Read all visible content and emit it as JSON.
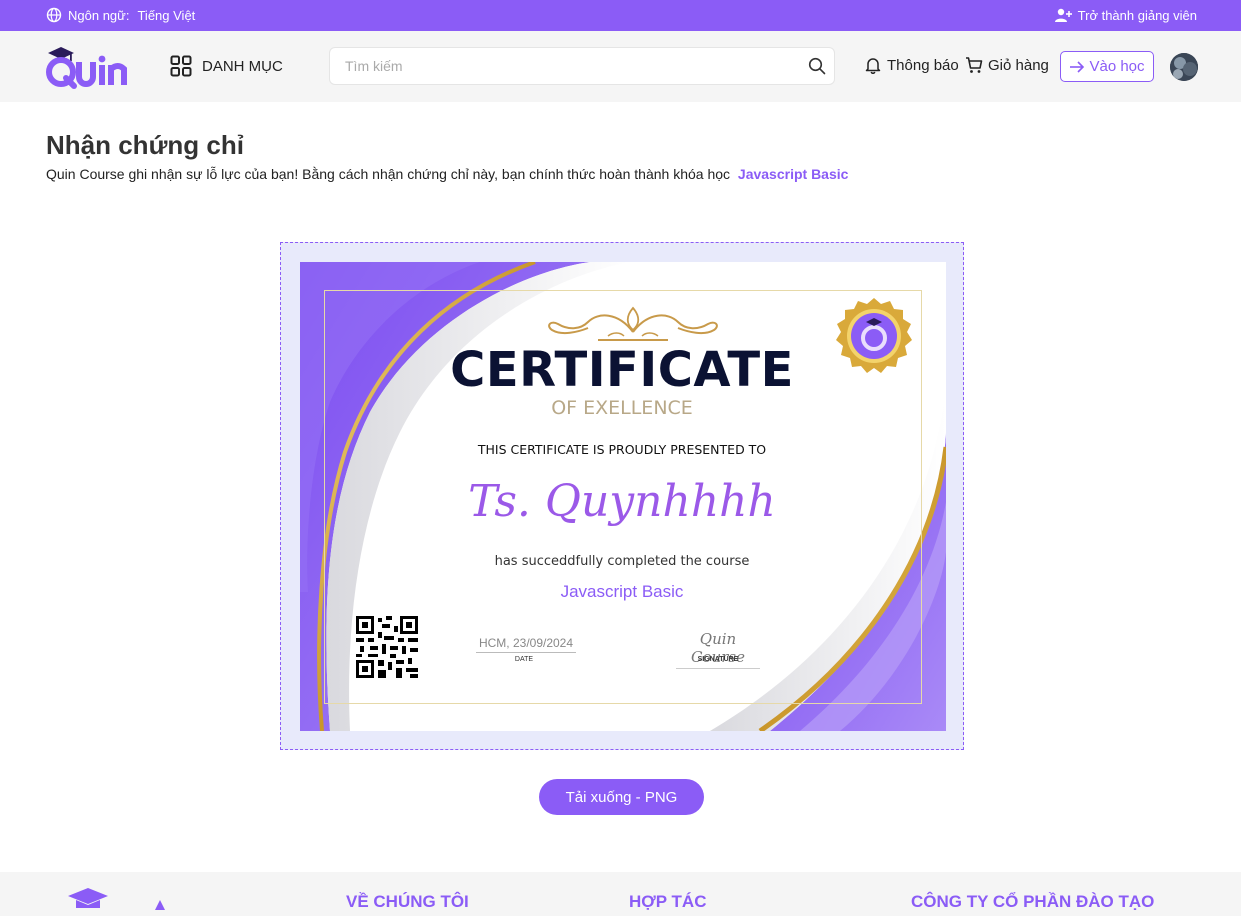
{
  "topbar": {
    "language_label": "Ngôn ngữ:",
    "language_value": "Tiếng Việt",
    "become_teacher": "Trở thành giảng viên"
  },
  "header": {
    "logo_text": "Quin",
    "category_label": "DANH MỤC",
    "search_placeholder": "Tìm kiếm",
    "notifications_label": "Thông báo",
    "cart_label": "Giỏ hàng",
    "enter_learning_label": "Vào học"
  },
  "page": {
    "title": "Nhận chứng chỉ",
    "description": "Quin Course ghi nhận sự lỗ lực của bạn! Bằng cách nhận chứng chỉ này, bạn chính thức hoàn thành khóa học",
    "course_name": "Javascript Basic"
  },
  "certificate": {
    "title": "CERTIFICATE",
    "subtitle": "OF EXELLENCE",
    "presented_to": "THIS CERTIFICATE IS PROUDLY PRESENTED TO",
    "recipient": "Ts. Quynhhhh",
    "completed_text": "has succeddfully completed the course",
    "course": "Javascript Basic",
    "date": "HCM, 23/09/2024",
    "date_label": "DATE",
    "signature": "Quin Course",
    "signature_label": "SIGNATURE"
  },
  "actions": {
    "download_label": "Tải xuống - PNG"
  },
  "footer": {
    "about": "VỀ CHÚNG TÔI",
    "partner": "HỢP TÁC",
    "company": "CÔNG TY CỔ PHẦN ĐÀO TẠO"
  },
  "colors": {
    "accent": "#8b5cf6",
    "gold": "#d4a93a",
    "navy": "#0b1233"
  }
}
